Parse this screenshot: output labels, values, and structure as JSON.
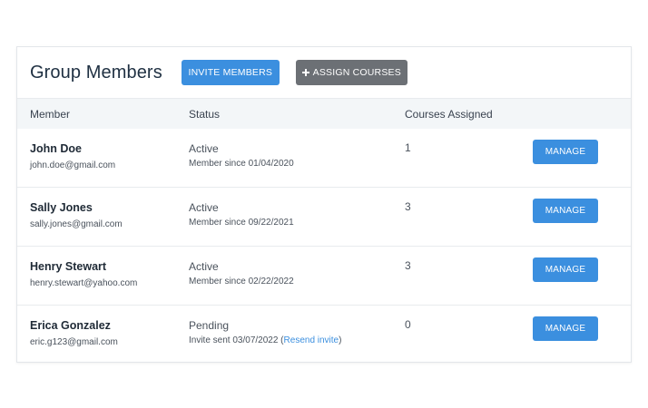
{
  "header": {
    "title": "Group Members",
    "invite_label": "Invite Members",
    "assign_label": "Assign Courses"
  },
  "columns": {
    "member": "Member",
    "status": "Status",
    "courses": "Courses Assigned"
  },
  "members": [
    {
      "name": "John Doe",
      "email": "john.doe@gmail.com",
      "status": "Active",
      "detail": "Member since 01/04/2020",
      "courses": "1",
      "manage_label": "Manage"
    },
    {
      "name": "Sally Jones",
      "email": "sally.jones@gmail.com",
      "status": "Active",
      "detail": "Member since 09/22/2021",
      "courses": "3",
      "manage_label": "Manage"
    },
    {
      "name": "Henry Stewart",
      "email": "henry.stewart@yahoo.com",
      "status": "Active",
      "detail": "Member since 02/22/2022",
      "courses": "3",
      "manage_label": "Manage"
    },
    {
      "name": "Erica Gonzalez",
      "email": "eric.g123@gmail.com",
      "status": "Pending",
      "detail": "Invite sent 03/07/2022 (",
      "resend_label": "Resend invite",
      "detail_suffix": ")",
      "courses": "0",
      "manage_label": "Manage"
    }
  ],
  "colors": {
    "primary": "#3b8fdf",
    "secondary": "#6c7075",
    "header_bg": "#f3f6f8"
  },
  "icons": {
    "assign_button_icon": "plus-icon"
  }
}
